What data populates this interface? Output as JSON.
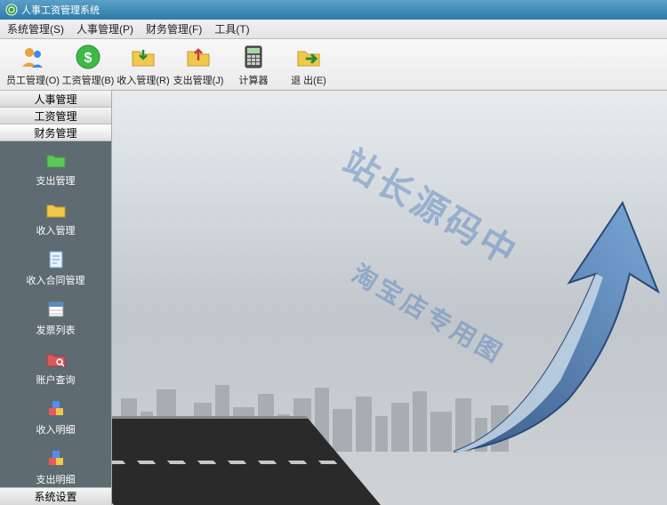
{
  "window": {
    "title": "人事工资管理系统"
  },
  "menu": {
    "items": [
      {
        "label": "系统管理(S)"
      },
      {
        "label": "人事管理(P)"
      },
      {
        "label": "财务管理(F)"
      },
      {
        "label": "工具(T)"
      }
    ]
  },
  "toolbar": {
    "items": [
      {
        "name": "employee-mgmt",
        "label": "员工管理(O)",
        "icon": "people"
      },
      {
        "name": "salary-mgmt",
        "label": "工资管理(B)",
        "icon": "money"
      },
      {
        "name": "income-mgmt",
        "label": "收入管理(R)",
        "icon": "folder-in"
      },
      {
        "name": "expense-mgmt",
        "label": "支出管理(J)",
        "icon": "folder-out"
      },
      {
        "name": "calculator",
        "label": "计算器",
        "icon": "calc"
      },
      {
        "name": "exit",
        "label": "退 出(E)",
        "icon": "exit"
      }
    ]
  },
  "sidebar": {
    "headers": [
      {
        "label": "人事管理",
        "active": false
      },
      {
        "label": "工资管理",
        "active": false
      },
      {
        "label": "财务管理",
        "active": true
      }
    ],
    "items": [
      {
        "name": "expense-mgmt",
        "label": "支出管理",
        "icon": "folder-green"
      },
      {
        "name": "income-mgmt",
        "label": "收入管理",
        "icon": "folder-yellow"
      },
      {
        "name": "income-contract",
        "label": "收入合同管理",
        "icon": "doc"
      },
      {
        "name": "invoice-list",
        "label": "发票列表",
        "icon": "sheet"
      },
      {
        "name": "account-query",
        "label": "账户查询",
        "icon": "folder-red"
      },
      {
        "name": "income-detail",
        "label": "收入明细",
        "icon": "boxes"
      },
      {
        "name": "expense-detail",
        "label": "支出明细",
        "icon": "boxes"
      }
    ],
    "footer": "系统设置"
  },
  "watermark": {
    "line1": "站长源码中",
    "line2": "淘宝店专用图"
  }
}
